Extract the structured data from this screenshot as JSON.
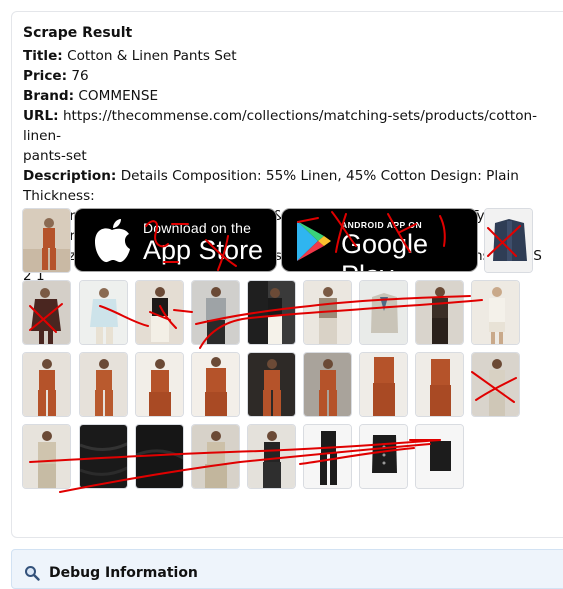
{
  "result": {
    "heading": "Scrape Result",
    "title_label": "Title:",
    "title": "Cotton & Linen Pants Set",
    "price_label": "Price:",
    "price": "76",
    "brand_label": "Brand:",
    "brand": "COMMENSE",
    "url_label": "URL:",
    "url_line1": "https://thecommense.com/collections/matching-sets/products/cotton-linen-",
    "url_line2": "pants-set",
    "description_label": "Description:",
    "description_line1": "Details Composition: 55% Linen, 45% Cotton Design: Plain Thickness:",
    "description_line2": "Regular Material: Cotton&Linen Size & Fit Stretch: Non-stretch Fit Type: Regular Fit Cm",
    "description_line3": "Inch Size US Shoulder Bust Waist Hips Top Length Bottom Length Inseam XS 2 1"
  },
  "badges": {
    "appstore_small": "Download on the",
    "appstore_big": "App Store",
    "googleplay_small": "ANDROID APP ON",
    "googleplay_big": "Google Play"
  },
  "debug": {
    "title": "Debug Information",
    "icon": "magnifier-icon"
  },
  "colors": {
    "rust": "#b5532a",
    "annotation_red": "#e00000",
    "debug_bg": "#eef4fb"
  }
}
